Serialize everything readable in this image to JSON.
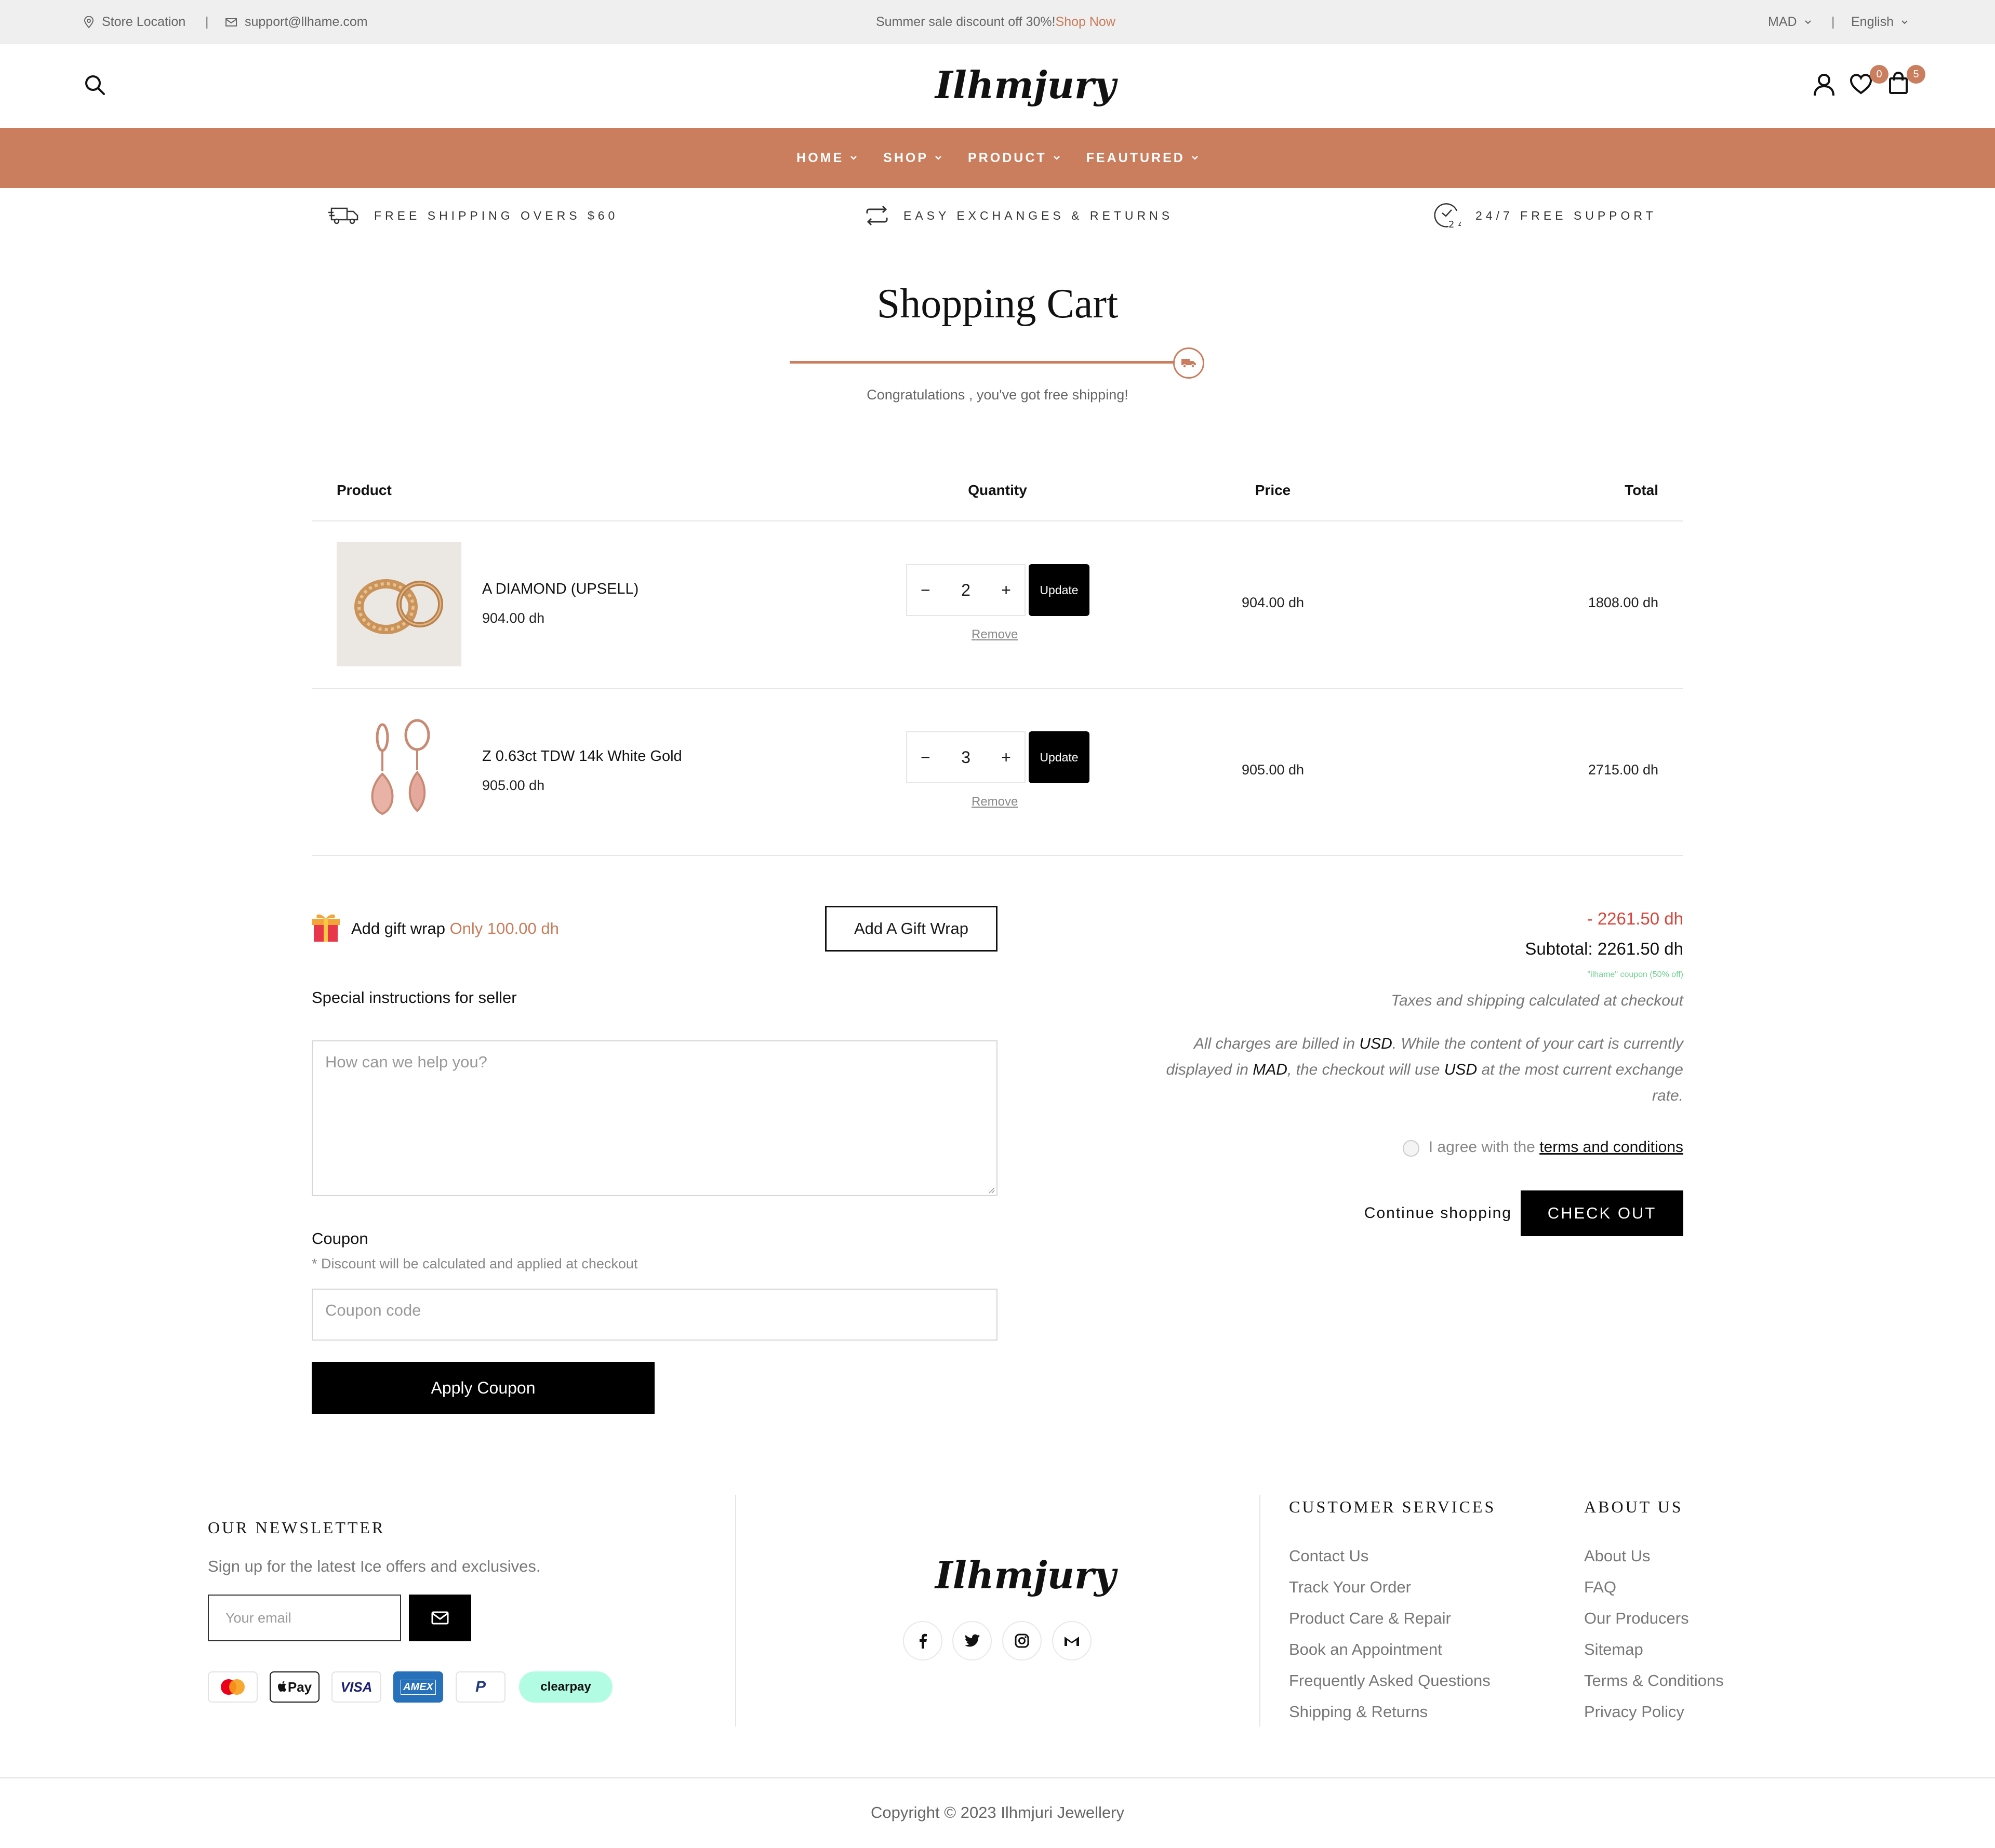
{
  "topbar": {
    "store_location": "Store Location",
    "email": "support@llhame.com",
    "promo_text": "Summer sale discount off 30%!",
    "promo_link": "Shop Now",
    "currency": "MAD",
    "language": "English",
    "separator": "|"
  },
  "header": {
    "logo": "Ilhmjury",
    "wishlist_count": "0",
    "cart_count": "5"
  },
  "nav": {
    "items": [
      {
        "label": "HOME"
      },
      {
        "label": "SHOP"
      },
      {
        "label": "PRODUCT"
      },
      {
        "label": "FEAUTURED"
      }
    ]
  },
  "features": [
    {
      "label": "FREE SHIPPING OVERS $60",
      "icon": "truck-icon"
    },
    {
      "label": "EASY EXCHANGES & RETURNS",
      "icon": "exchange-icon"
    },
    {
      "label": "24/7 FREE SUPPORT",
      "icon": "support-24-icon"
    }
  ],
  "cart": {
    "title": "Shopping Cart",
    "shipping_message": "Congratulations , you've got free shipping!",
    "shipping_progress": 1.0,
    "columns": {
      "product": "Product",
      "quantity": "Quantity",
      "price": "Price",
      "total": "Total"
    },
    "items": [
      {
        "name": "A DIAMOND (UPSELL)",
        "unit_price": "904.00 dh",
        "quantity": "2",
        "price": "904.00 dh",
        "total": "1808.00 dh",
        "update_label": "Update",
        "remove_label": "Remove"
      },
      {
        "name": "Z 0.63ct TDW 14k White Gold",
        "unit_price": "905.00 dh",
        "quantity": "3",
        "price": "905.00 dh",
        "total": "2715.00 dh",
        "update_label": "Update",
        "remove_label": "Remove"
      }
    ],
    "qty_minus": "−",
    "qty_plus": "+"
  },
  "gift": {
    "label": "Add gift wrap",
    "price_text": "Only 100.00 dh",
    "button": "Add A Gift Wrap"
  },
  "instructions": {
    "label": "Special instructions for seller",
    "placeholder": "How can we help you?"
  },
  "coupon": {
    "label": "Coupon",
    "note": "* Discount will be calculated and applied at checkout",
    "placeholder": "Coupon code",
    "button": "Apply Coupon"
  },
  "summary": {
    "discount": "- 2261.50 dh",
    "subtotal": "Subtotal: 2261.50 dh",
    "coupon_note": "\"ilhame\" coupon (50% off)",
    "tax_note": "Taxes and shipping calculated at checkout",
    "billing_1": "All charges are billed in ",
    "billing_usd": "USD",
    "billing_2": ". While the content of your cart is currently displayed in ",
    "billing_mad": "MAD",
    "billing_3": ", the checkout will use ",
    "billing_usd2": "USD",
    "billing_4": " at the most current exchange rate.",
    "agree_text": "I agree with the ",
    "terms_link": "terms and conditions",
    "continue": "Continue shopping",
    "checkout": "CHECK OUT"
  },
  "footer": {
    "newsletter_title": "OUR NEWSLETTER",
    "newsletter_text": "Sign up for the latest Ice offers and exclusives.",
    "email_placeholder": "Your email",
    "logo": "Ilhmjury",
    "payments": [
      "Mastercard",
      "Apple Pay",
      "VISA",
      "AMEX",
      "PayPal",
      "clearpay"
    ],
    "apple_pay_label": "Pay",
    "visa_label": "VISA",
    "amex_label": "AMEX",
    "paypal_label": "P",
    "clearpay_label": "clearpay",
    "customer_services_title": "CUSTOMER SERVICES",
    "customer_services": [
      "Contact Us",
      "Track Your Order",
      "Product Care & Repair",
      "Book an Appointment",
      "Frequently Asked Questions",
      "Shipping & Returns"
    ],
    "about_title": "ABOUT US",
    "about_links": [
      "About Us",
      "FAQ",
      "Our Producers",
      "Sitemap",
      "Terms & Conditions",
      "Privacy Policy"
    ],
    "copyright": "Copyright © 2023 Ilhmjuri Jewellery"
  },
  "colors": {
    "accent": "#cb7e5e",
    "discount_red": "#d9453a",
    "coupon_green": "#6fcf8f",
    "clearpay": "#b2fce4"
  }
}
